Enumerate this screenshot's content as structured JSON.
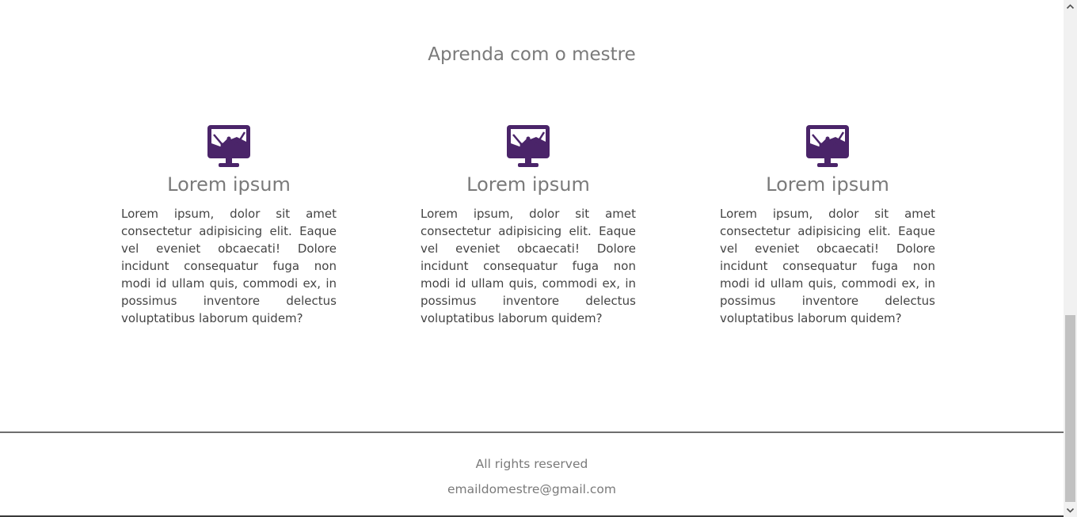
{
  "section": {
    "title": "Aprenda com o mestre"
  },
  "cards": [
    {
      "icon": "monitor-chart-icon",
      "title": "Lorem ipsum",
      "text": "Lorem ipsum, dolor sit amet consectetur adipisicing elit. Eaque vel eveniet obcaecati! Dolore incidunt consequatur fuga non modi id ullam quis, commodi ex, in possimus inventore delectus voluptatibus laborum quidem?"
    },
    {
      "icon": "monitor-chart-icon",
      "title": "Lorem ipsum",
      "text": "Lorem ipsum, dolor sit amet consectetur adipisicing elit. Eaque vel eveniet obcaecati! Dolore incidunt consequatur fuga non modi id ullam quis, commodi ex, in possimus inventore delectus voluptatibus laborum quidem?"
    },
    {
      "icon": "monitor-chart-icon",
      "title": "Lorem ipsum",
      "text": "Lorem ipsum, dolor sit amet consectetur adipisicing elit. Eaque vel eveniet obcaecati! Dolore incidunt consequatur fuga non modi id ullam quis, commodi ex, in possimus inventore delectus voluptatibus laborum quidem?"
    }
  ],
  "footer": {
    "rights": "All rights reserved",
    "email": "emaildomestre@gmail.com"
  },
  "colors": {
    "accent": "#4a2469",
    "text_muted": "#7a7a7a",
    "text_body": "#444444"
  }
}
